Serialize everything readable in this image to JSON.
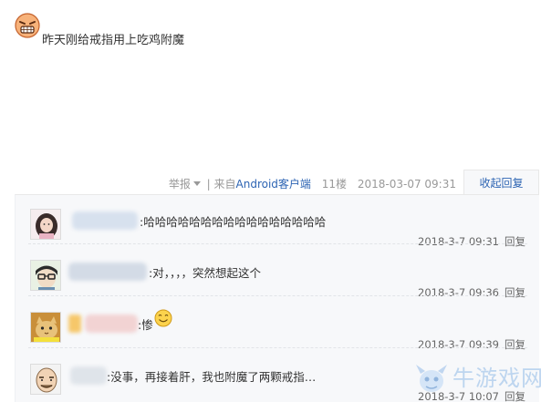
{
  "post": {
    "emoji_icon": "grinning-mad-face-icon",
    "text": "昨天刚给戒指用上吃鸡附魔"
  },
  "meta": {
    "report": "举报",
    "from_prefix": "| 来自",
    "client": "Android客户端",
    "floor": "11楼",
    "date": "2018-03-07 09:31",
    "collapse_label": "收起回复"
  },
  "replies": [
    {
      "text": ":哈哈哈哈哈哈哈哈哈哈哈哈哈哈哈哈",
      "time": "2018-3-7 09:31",
      "reply_label": "回复",
      "avatar": "girl-avatar"
    },
    {
      "text": ":对，，，，突然想起这个",
      "time": "2018-3-7 09:36",
      "reply_label": "回复",
      "avatar": "glasses-boy-avatar"
    },
    {
      "text": ":惨",
      "time": "2018-3-7 09:39",
      "reply_label": "回复",
      "avatar": "cat-photo-avatar",
      "emoji_icon": "smile-face-icon"
    },
    {
      "text": ":没事，再接着肝，我也附魔了两颗戒指…",
      "time": "2018-3-7 10:07",
      "reply_label": "回复",
      "avatar": "bald-cartoon-avatar"
    }
  ],
  "watermark": {
    "text": "牛游戏网",
    "icon": "mascot-logo-icon"
  },
  "colors": {
    "link": "#2d64b3",
    "meta_gray": "#999999",
    "reply_bg": "#f7f8fa"
  }
}
